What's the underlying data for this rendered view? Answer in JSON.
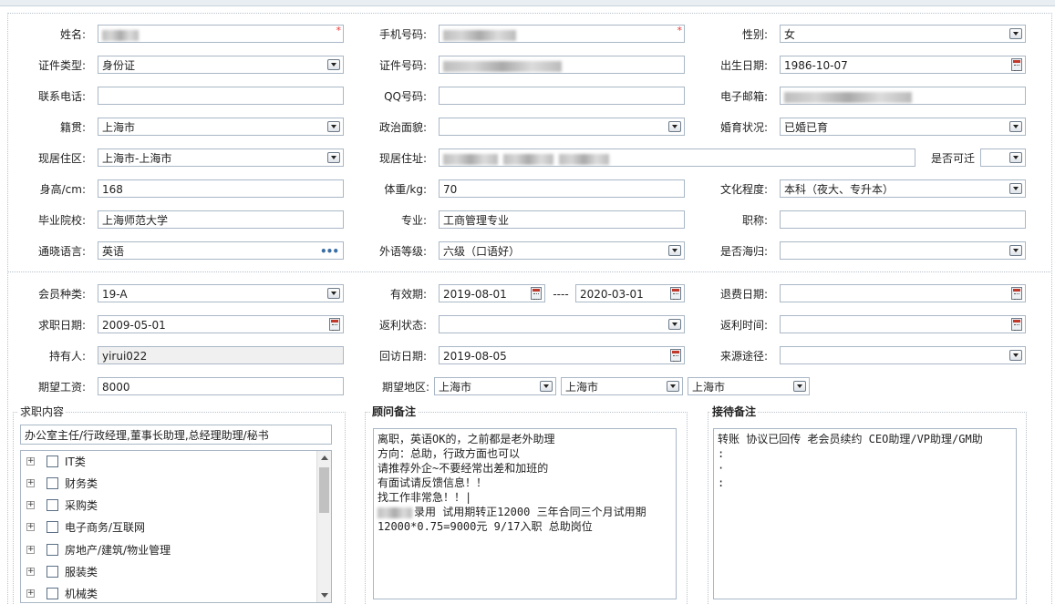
{
  "row1": {
    "name_label": "姓名:",
    "name_value": "",
    "phone_label": "手机号码:",
    "phone_value": "",
    "gender_label": "性别:",
    "gender_value": "女"
  },
  "row2": {
    "idtype_label": "证件类型:",
    "idtype_value": "身份证",
    "idno_label": "证件号码:",
    "idno_value": "",
    "birth_label": "出生日期:",
    "birth_value": "1986-10-07"
  },
  "row3": {
    "tel_label": "联系电话:",
    "tel_value": "",
    "qq_label": "QQ号码:",
    "qq_value": "",
    "email_label": "电子邮箱:",
    "email_value": ""
  },
  "row4": {
    "native_label": "籍贯:",
    "native_value": "上海市",
    "political_label": "政治面貌:",
    "political_value": "",
    "marital_label": "婚育状况:",
    "marital_value": "已婚已育"
  },
  "row5": {
    "residence_label": "现居住区:",
    "residence_value": "上海市-上海市",
    "address_label": "现居住址:",
    "address_value": "",
    "relocate_label": "是否可迁",
    "relocate_value": ""
  },
  "row6": {
    "height_label": "身高/cm:",
    "height_value": "168",
    "weight_label": "体重/kg:",
    "weight_value": "70",
    "education_label": "文化程度:",
    "education_value": "本科（夜大、专升本）"
  },
  "row7": {
    "school_label": "毕业院校:",
    "school_value": "上海师范大学",
    "major_label": "专业:",
    "major_value": "工商管理专业",
    "title_label": "职称:",
    "title_value": ""
  },
  "row8": {
    "lang_label": "通晓语言:",
    "lang_value": "英语",
    "lang_more": "•••",
    "foreign_label": "外语等级:",
    "foreign_value": "六级（口语好）",
    "overseas_label": "是否海归:",
    "overseas_value": ""
  },
  "row9": {
    "member_label": "会员种类:",
    "member_value": "19-A",
    "valid_label": "有效期:",
    "valid_from": "2019-08-01",
    "valid_sep": "----",
    "valid_to": "2020-03-01",
    "refund_label": "退费日期:",
    "refund_value": ""
  },
  "row10": {
    "jobdate_label": "求职日期:",
    "jobdate_value": "2009-05-01",
    "rebate_label": "返利状态:",
    "rebate_value": "",
    "rebatetime_label": "返利时间:",
    "rebatetime_value": ""
  },
  "row11": {
    "holder_label": "持有人:",
    "holder_value": "yirui022",
    "visit_label": "回访日期:",
    "visit_value": "2019-08-05",
    "source_label": "来源途径:",
    "source_value": ""
  },
  "row12": {
    "salary_label": "期望工资:",
    "salary_value": "8000",
    "area_label": "期望地区:",
    "area1": "上海市",
    "area2": "上海市",
    "area3": "上海市"
  },
  "job": {
    "section_label": "求职内容",
    "summary": "办公室主任/行政经理,董事长助理,总经理助理/秘书",
    "tree": [
      "IT类",
      "财务类",
      "采购类",
      "电子商务/互联网",
      "房地产/建筑/物业管理",
      "服装类",
      "机械类"
    ]
  },
  "advisor": {
    "section_label": "顾问备注",
    "lines": [
      "离职，英语OK的，之前都是老外助理",
      "方向：总助，行政方面也可以",
      "请推荐外企~不要经常出差和加班的",
      "有面试请反馈信息！！",
      "找工作非常急！！|",
      "录用 试用期转正12000 三年合同三个月试用期",
      "12000*0.75=9000元 9/17入职 总助岗位"
    ]
  },
  "reception": {
    "section_label": "接待备注",
    "lines": [
      "转账 协议已回传 老会员续约 CEO助理/VP助理/GM助",
      ":",
      "·",
      ":"
    ]
  },
  "colors": {
    "border": "#a9b7c6",
    "required": "#ee3333",
    "readonly_bg": "#f0f0f0"
  }
}
